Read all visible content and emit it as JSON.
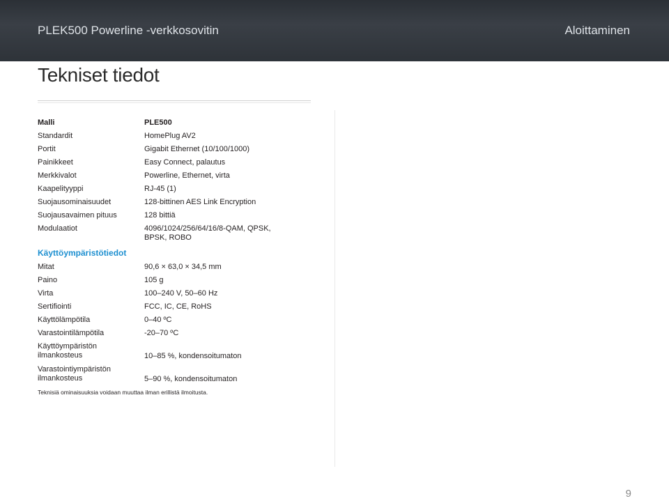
{
  "header": {
    "product": "PLEK500 Powerline -verkkosovitin",
    "section": "Aloittaminen"
  },
  "page": {
    "title": "Tekniset tiedot",
    "number": "9"
  },
  "specs": [
    {
      "label": "Malli",
      "value": "PLE500",
      "bold": true
    },
    {
      "label": "Standardit",
      "value": "HomePlug AV2"
    },
    {
      "label": "Portit",
      "value": "Gigabit Ethernet (10/100/1000)"
    },
    {
      "label": "Painikkeet",
      "value": "Easy Connect, palautus"
    },
    {
      "label": "Merkkivalot",
      "value": "Powerline, Ethernet, virta"
    },
    {
      "label": "Kaapelityyppi",
      "value": "RJ-45 (1)"
    },
    {
      "label": "Suojausominaisuudet",
      "value": "128-bittinen AES Link Encryption"
    },
    {
      "label": "Suojausavaimen pituus",
      "value": "128 bittiä"
    },
    {
      "label": "Modulaatiot",
      "value": "4096/1024/256/64/16/8-QAM, QPSK,\nBPSK, ROBO"
    }
  ],
  "environment": {
    "heading": "Käyttöympäristötiedot",
    "rows": [
      {
        "label": "Mitat",
        "value": "90,6 × 63,0 × 34,5 mm"
      },
      {
        "label": "Paino",
        "value": "105 g"
      },
      {
        "label": "Virta",
        "value": "100–240 V, 50–60 Hz"
      },
      {
        "label": "Sertifiointi",
        "value": "FCC, IC, CE, RoHS"
      },
      {
        "label": "Käyttölämpötila",
        "value": "0–40 ºC"
      },
      {
        "label": "Varastointilämpötila",
        "value": "-20–70 ºC"
      },
      {
        "label": "Käyttöympäristön\nilmankosteus",
        "value": "10–85 %, kondensoitumaton"
      },
      {
        "label": "Varastointiympäristön\nilmankosteus",
        "value": "5–90 %, kondensoitumaton"
      }
    ]
  },
  "footnote": "Teknisiä ominaisuuksia voidaan muuttaa ilman erillistä ilmoitusta."
}
